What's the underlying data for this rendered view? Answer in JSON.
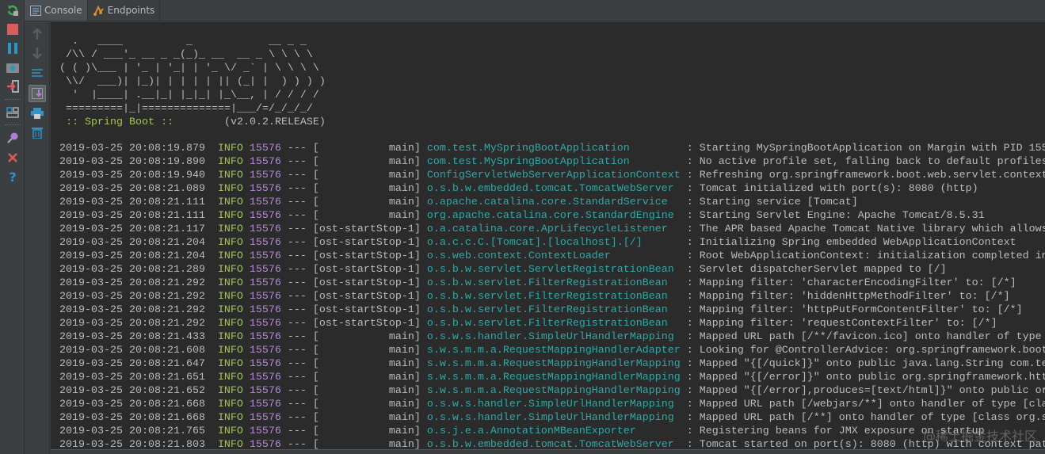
{
  "tabs": [
    {
      "label": "Console",
      "icon": "console-icon"
    },
    {
      "label": "Endpoints",
      "icon": "endpoints-icon"
    }
  ],
  "banner": {
    "art": [
      "  .   ____          _            __ _ _",
      " /\\\\ / ___'_ __ _ _(_)_ __  __ _ \\ \\ \\ \\",
      "( ( )\\___ | '_ | '_| | '_ \\/ _` | \\ \\ \\ \\",
      " \\\\/  ___)| |_)| | | | | || (_| |  ) ) ) )",
      "  '  |____| .__|_| |_|_| |_\\__, | / / / /",
      " =========|_|==============|___/=/_/_/_/"
    ],
    "boot_label": " :: Spring Boot :: ",
    "version": "       (v2.0.2.RELEASE)"
  },
  "log": [
    {
      "time": "2019-03-25 20:08:19.879",
      "level": "INFO",
      "pid": "15576",
      "thread": "main",
      "logger": "com.test.MySpringBootApplication",
      "message": "Starting MySpringBootApplication on Margin with PID 155"
    },
    {
      "time": "2019-03-25 20:08:19.890",
      "level": "INFO",
      "pid": "15576",
      "thread": "main",
      "logger": "com.test.MySpringBootApplication",
      "message": "No active profile set, falling back to default profiles"
    },
    {
      "time": "2019-03-25 20:08:19.940",
      "level": "INFO",
      "pid": "15576",
      "thread": "main",
      "logger": "ConfigServletWebServerApplicationContext",
      "message": "Refreshing org.springframework.boot.web.servlet.context"
    },
    {
      "time": "2019-03-25 20:08:21.089",
      "level": "INFO",
      "pid": "15576",
      "thread": "main",
      "logger": "o.s.b.w.embedded.tomcat.TomcatWebServer",
      "message": "Tomcat initialized with port(s): 8080 (http)"
    },
    {
      "time": "2019-03-25 20:08:21.111",
      "level": "INFO",
      "pid": "15576",
      "thread": "main",
      "logger": "o.apache.catalina.core.StandardService",
      "message": "Starting service [Tomcat]"
    },
    {
      "time": "2019-03-25 20:08:21.111",
      "level": "INFO",
      "pid": "15576",
      "thread": "main",
      "logger": "org.apache.catalina.core.StandardEngine",
      "message": "Starting Servlet Engine: Apache Tomcat/8.5.31"
    },
    {
      "time": "2019-03-25 20:08:21.117",
      "level": "INFO",
      "pid": "15576",
      "thread": "ost-startStop-1",
      "logger": "o.a.catalina.core.AprLifecycleListener",
      "message": "The APR based Apache Tomcat Native library which allows"
    },
    {
      "time": "2019-03-25 20:08:21.204",
      "level": "INFO",
      "pid": "15576",
      "thread": "ost-startStop-1",
      "logger": "o.a.c.c.C.[Tomcat].[localhost].[/]",
      "message": "Initializing Spring embedded WebApplicationContext"
    },
    {
      "time": "2019-03-25 20:08:21.204",
      "level": "INFO",
      "pid": "15576",
      "thread": "ost-startStop-1",
      "logger": "o.s.web.context.ContextLoader",
      "message": "Root WebApplicationContext: initialization completed in"
    },
    {
      "time": "2019-03-25 20:08:21.289",
      "level": "INFO",
      "pid": "15576",
      "thread": "ost-startStop-1",
      "logger": "o.s.b.w.servlet.ServletRegistrationBean",
      "message": "Servlet dispatcherServlet mapped to [/]"
    },
    {
      "time": "2019-03-25 20:08:21.292",
      "level": "INFO",
      "pid": "15576",
      "thread": "ost-startStop-1",
      "logger": "o.s.b.w.servlet.FilterRegistrationBean",
      "message": "Mapping filter: 'characterEncodingFilter' to: [/*]"
    },
    {
      "time": "2019-03-25 20:08:21.292",
      "level": "INFO",
      "pid": "15576",
      "thread": "ost-startStop-1",
      "logger": "o.s.b.w.servlet.FilterRegistrationBean",
      "message": "Mapping filter: 'hiddenHttpMethodFilter' to: [/*]"
    },
    {
      "time": "2019-03-25 20:08:21.292",
      "level": "INFO",
      "pid": "15576",
      "thread": "ost-startStop-1",
      "logger": "o.s.b.w.servlet.FilterRegistrationBean",
      "message": "Mapping filter: 'httpPutFormContentFilter' to: [/*]"
    },
    {
      "time": "2019-03-25 20:08:21.292",
      "level": "INFO",
      "pid": "15576",
      "thread": "ost-startStop-1",
      "logger": "o.s.b.w.servlet.FilterRegistrationBean",
      "message": "Mapping filter: 'requestContextFilter' to: [/*]"
    },
    {
      "time": "2019-03-25 20:08:21.433",
      "level": "INFO",
      "pid": "15576",
      "thread": "main",
      "logger": "o.s.w.s.handler.SimpleUrlHandlerMapping",
      "message": "Mapped URL path [/**/favicon.ico] onto handler of type"
    },
    {
      "time": "2019-03-25 20:08:21.608",
      "level": "INFO",
      "pid": "15576",
      "thread": "main",
      "logger": "s.w.s.m.m.a.RequestMappingHandlerAdapter",
      "message": "Looking for @ControllerAdvice: org.springframework.boot"
    },
    {
      "time": "2019-03-25 20:08:21.647",
      "level": "INFO",
      "pid": "15576",
      "thread": "main",
      "logger": "s.w.s.m.m.a.RequestMappingHandlerMapping",
      "message": "Mapped \"{[/quick]}\" onto public java.lang.String com.te"
    },
    {
      "time": "2019-03-25 20:08:21.651",
      "level": "INFO",
      "pid": "15576",
      "thread": "main",
      "logger": "s.w.s.m.m.a.RequestMappingHandlerMapping",
      "message": "Mapped \"{[/error]}\" onto public org.springframework.htt"
    },
    {
      "time": "2019-03-25 20:08:21.652",
      "level": "INFO",
      "pid": "15576",
      "thread": "main",
      "logger": "s.w.s.m.m.a.RequestMappingHandlerMapping",
      "message": "Mapped \"{[/error],produces=[text/html]}\" onto public or"
    },
    {
      "time": "2019-03-25 20:08:21.668",
      "level": "INFO",
      "pid": "15576",
      "thread": "main",
      "logger": "o.s.w.s.handler.SimpleUrlHandlerMapping",
      "message": "Mapped URL path [/webjars/**] onto handler of type [cla"
    },
    {
      "time": "2019-03-25 20:08:21.668",
      "level": "INFO",
      "pid": "15576",
      "thread": "main",
      "logger": "o.s.w.s.handler.SimpleUrlHandlerMapping",
      "message": "Mapped URL path [/**] onto handler of type [class org.s"
    },
    {
      "time": "2019-03-25 20:08:21.765",
      "level": "INFO",
      "pid": "15576",
      "thread": "main",
      "logger": "o.s.j.e.a.AnnotationMBeanExporter",
      "message": "Registering beans for JMX exposure on startup"
    },
    {
      "time": "2019-03-25 20:08:21.803",
      "level": "INFO",
      "pid": "15576",
      "thread": "main",
      "logger": "o.s.b.w.embedded.tomcat.TomcatWebServer",
      "message": "Tomcat started on port(s): 8080 (http) with context pat"
    }
  ],
  "separator": "---",
  "watermark": "@稀土掘金技术社区",
  "colors": {
    "background": "#2b2b2b",
    "info": "#a5c25c",
    "pid": "#b589d6",
    "logger": "#2fa8a8"
  }
}
